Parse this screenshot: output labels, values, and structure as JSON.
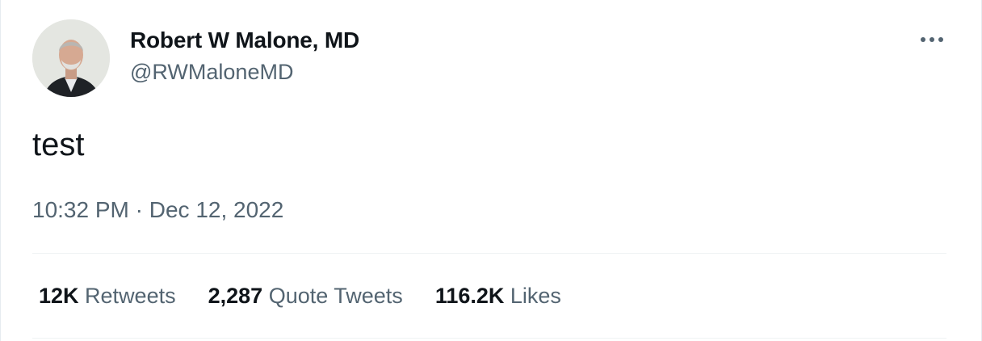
{
  "author": {
    "display_name": "Robert W Malone, MD",
    "handle": "@RWMaloneMD"
  },
  "tweet": {
    "text": "test"
  },
  "timestamp": {
    "time": "10:32 PM",
    "separator": " · ",
    "date": "Dec 12, 2022"
  },
  "stats": [
    {
      "count": "12K",
      "label": "Retweets"
    },
    {
      "count": "2,287",
      "label": "Quote Tweets"
    },
    {
      "count": "116.2K",
      "label": "Likes"
    }
  ],
  "icons": {
    "more": "more-horizontal-icon",
    "avatar": "profile-photo"
  },
  "colors": {
    "text_primary": "#0f1419",
    "text_secondary": "#536471",
    "divider": "#eff3f4"
  }
}
